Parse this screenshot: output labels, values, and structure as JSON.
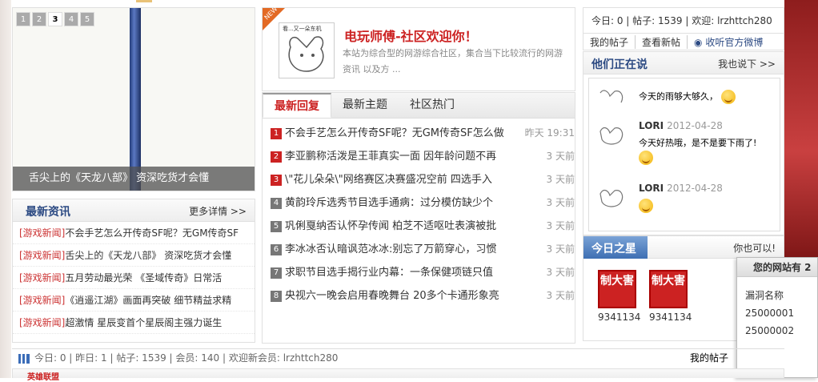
{
  "slider": {
    "pages": [
      "1",
      "2",
      "3",
      "4",
      "5"
    ],
    "active_index": 2,
    "caption": "舌尖上的《天龙八部》 资深吃货才会懂"
  },
  "news": {
    "title": "最新资讯",
    "more": "更多详情 >>",
    "items": [
      {
        "tag": "[游戏新闻]",
        "text": "不会手艺怎么开传奇SF呢？无GM传奇SF"
      },
      {
        "tag": "[游戏新闻]",
        "text": "舌尖上的《天龙八部》 资深吃货才会懂"
      },
      {
        "tag": "[游戏新闻]",
        "text": "五月劳动最光荣 《圣域传奇》日常活"
      },
      {
        "tag": "[游戏新闻]",
        "text": "《逍遥江湖》画面再突破 细节精益求精"
      },
      {
        "tag": "[游戏新闻]",
        "text": "超激情 星辰变首个星辰阁主强力诞生"
      }
    ]
  },
  "welcome": {
    "badge": "NEW",
    "avatar_text": "看...又一朵东机",
    "title": "电玩师傅-社区欢迎你！",
    "desc": "本站为综合型的网游综合社区，集合当下比较流行的网游资讯 以及方 ..."
  },
  "tabs": [
    "最新回复",
    "最新主题",
    "社区热门"
  ],
  "topics": [
    {
      "n": "1",
      "text": "不会手艺怎么开传奇SF呢？无GM传奇SF怎么做",
      "time": "昨天 19:31"
    },
    {
      "n": "2",
      "text": "李亚鹏称活泼是王菲真实一面 因年龄问题不再",
      "time": "3 天前"
    },
    {
      "n": "3",
      "text": "\\\"花儿朵朵\\\"网络赛区决赛盛况空前 四选手入",
      "time": "3 天前"
    },
    {
      "n": "4",
      "text": "黄韵玲斥选秀节目选手通病：过分模仿缺少个",
      "time": "3 天前"
    },
    {
      "n": "5",
      "text": "巩俐戛纳否认怀孕传闻 柏芝不适呕吐表演被批",
      "time": "3 天前"
    },
    {
      "n": "6",
      "text": "李冰冰否认暗讽范冰冰:别忘了万箭穿心，习惯",
      "time": "3 天前"
    },
    {
      "n": "7",
      "text": "求职节目选手揭行业内幕：一条保健项链只值",
      "time": "3 天前"
    },
    {
      "n": "8",
      "text": "央视六一晚会启用春晚舞台 20多个卡通形象亮",
      "time": "3 天前"
    }
  ],
  "stats": "今日: 0 | 帖子: 1539 | 欢迎: lrzhttch280",
  "links": [
    "我的帖子",
    "查看新帖",
    "收听官方微博"
  ],
  "talk": {
    "title": "他们正在说",
    "more": "我也说下 >>",
    "messages": [
      {
        "name": "",
        "date": "",
        "text": "今天的雨够大够久，"
      },
      {
        "name": "LORI",
        "date": "2012-04-28",
        "text": "今天好热哦，是不是要下雨了!"
      },
      {
        "name": "LORI",
        "date": "2012-04-28",
        "text": ""
      }
    ]
  },
  "star": {
    "title": "今日之星",
    "more": "你也可以!",
    "stamps": [
      {
        "label": "制大害",
        "num": "9341134"
      },
      {
        "label": "制大害",
        "num": "9341134"
      }
    ]
  },
  "popup": {
    "title": "您的网站有 2",
    "col": "漏洞名称",
    "rows": [
      "25000001",
      "25000002"
    ]
  },
  "bottom": {
    "stats": "今日: 0 | 昨日: 1 | 帖子: 1539 | 会员: 140 | 欢迎新会员: lrzhttch280",
    "my_posts": "我的帖子",
    "lower_title": "英雄联盟"
  }
}
